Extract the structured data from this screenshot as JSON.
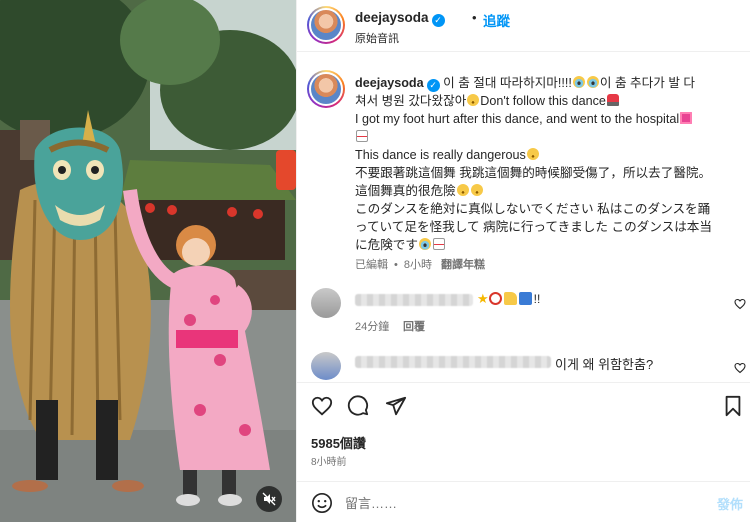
{
  "post": {
    "username": "deejaysoda",
    "separator": "•",
    "follow_label": "追蹤",
    "audio_label": "原始音訊",
    "likes": "5985個讚",
    "time": "8小時前"
  },
  "caption": {
    "username": "deejaysoda",
    "line1_a": "이 춤 절대 따라하지마!!!!",
    "line1_b": "이 춤 추다가 발 다",
    "line2_a": "쳐서 병원 갔다왔잖아",
    "line2_b": "Don't follow this dance",
    "line3": "I got my foot hurt after this dance, and went to the hospital",
    "line5": "This dance is really dangerous",
    "line6": "不要跟著跳這個舞 我跳這個舞的時候腳受傷了，所以去了醫院。",
    "line7": "這個舞真的很危險",
    "line8": "このダンスを絶対に真似しないでください 私はこのダンスを踊",
    "line9": "っていて足を怪我して 病院に行ってきました このダンスは本当",
    "line10": "に危険です",
    "edited": "已編輯",
    "age": "8小時",
    "see_translation": "翻譯年糕"
  },
  "comments": [
    {
      "sub_time": "24分鐘",
      "reply_label": "回覆",
      "suffix": "!!"
    },
    {
      "text": "이게 왜 위함한춤?"
    }
  ],
  "composer": {
    "placeholder": "留言……",
    "post_label": "發佈"
  },
  "icons": {
    "like": "heart-icon",
    "comment": "comment-bubble-icon",
    "share": "paper-plane-icon",
    "save": "bookmark-icon",
    "emoji": "smiley-icon",
    "mute": "speaker-muted-icon",
    "verified": "verified-badge-icon"
  },
  "colors": {
    "accent": "#0095f6",
    "text": "#262626",
    "muted": "#737373",
    "border": "#efefef"
  }
}
